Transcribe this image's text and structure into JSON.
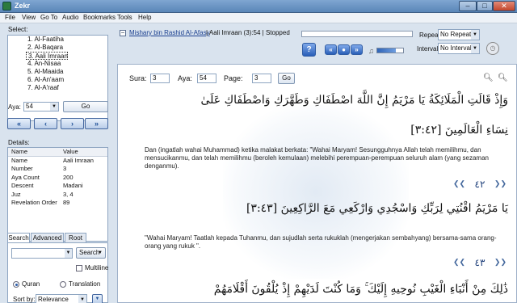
{
  "window": {
    "title": "Zekr",
    "min": "–",
    "max": "□",
    "close": "✕"
  },
  "menu": [
    "File",
    "View",
    "Go To",
    "Audio",
    "Bookmarks",
    "Tools",
    "Help"
  ],
  "left": {
    "select_label": "Select:",
    "surahs": [
      "1. Al-Faatiha",
      "2. Al-Baqara",
      "3. Aali Imraan",
      "4. An-Nisaa",
      "5. Al-Maaida",
      "6. Al-An'aam",
      "7. Al-A'raaf"
    ],
    "selected_index": 2,
    "aya_label": "Aya:",
    "aya_value": "54",
    "go_label": "Go",
    "nav_buttons": [
      "«",
      "‹",
      "›",
      "»"
    ],
    "details_label": "Details:",
    "details_header": {
      "name": "Name",
      "value": "Value"
    },
    "details": [
      {
        "name": "Name",
        "value": "Aali Imraan"
      },
      {
        "name": "Number",
        "value": "3"
      },
      {
        "name": "Aya Count",
        "value": "200"
      },
      {
        "name": "Descent",
        "value": "Madani"
      },
      {
        "name": "Juz",
        "value": "3, 4"
      },
      {
        "name": "Revelation Order",
        "value": "89"
      }
    ],
    "tabs": [
      "Search",
      "Advanced",
      "Root"
    ],
    "search_button": "Search",
    "multiline_label": "Multiline",
    "radio_quran": "Quran",
    "radio_translation": "Translation",
    "sort_label": "Sort by:",
    "sort_value": "Relevance"
  },
  "player": {
    "collapse": "−",
    "reciter": "Mishary bin Rashid Al-Afasy",
    "status": "| Aali Imraan (3):54 | Stopped",
    "repeat_label": "Repeat:",
    "repeat_value": "No Repeat",
    "interval_label": "Interval:",
    "interval_value": "No Interval",
    "play_icon": "?",
    "clock_icon": "◷"
  },
  "reader": {
    "sura_label": "Sura:",
    "sura_value": "3",
    "aya_label": "Aya:",
    "aya_value": "54",
    "page_label": "Page:",
    "page_value": "3",
    "go_label": "Go",
    "verse42_line1": "وَإِذْ قَالَتِ الْمَلَائِكَةُ يَا مَرْيَمُ إِنَّ اللَّهَ اصْطَفَاكِ وَطَهَّرَكِ وَاصْطَفَاكِ عَلَىٰ",
    "verse42_line2": "نِسَاءِ الْعَالَمِينَ [٣:٤٢]",
    "trans42": "Dan (ingatlah wahai Muhammad) ketika malakat berkata: \"Wahai Maryam! Sesungguhnya Allah telah memilihmu, dan mensucikanmu, dan telah memilihmu (beroleh kemulaan) melebihi perempuan-perempuan seluruh alam (yang sezaman denganmu).",
    "mark42": "٤٢",
    "verse43": "يَا مَرْيَمُ اقْنُتِي لِرَبِّكِ وَاسْجُدِي وَارْكَعِي مَعَ الرَّاكِعِينَ [٣:٤٣]",
    "trans43": "\"Wahai Maryam! Taatlah kepada Tuhanmu, dan sujudlah serta rukuklah (mengerjakan sembahyang) bersama-sama orang-orang yang rukuk \".",
    "mark43": "٤٣",
    "verse44_partial": "ذَٰلِكَ مِنْ أَنْبَاءِ الْغَيْبِ نُوحِيهِ إِلَيْكَ ۚ وَمَا كُنْتَ لَدَيْهِمْ إِذْ يُلْقُونَ أَقْلَامَهُمْ"
  }
}
